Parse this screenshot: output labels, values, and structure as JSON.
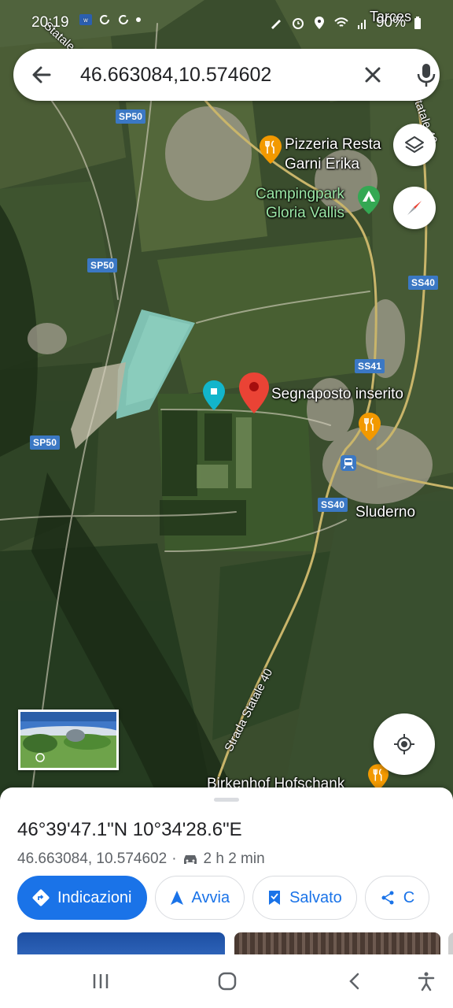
{
  "status_bar": {
    "time": "20:19",
    "battery": "90%"
  },
  "search": {
    "query": "46.663084,10.574602"
  },
  "map": {
    "place_labels": {
      "top_right": "Tarces",
      "pizzeria_line1": "Pizzeria Resta",
      "pizzeria_line2": "Garni Erika",
      "camping_line1": "Campingpark",
      "camping_line2": "Gloria Vallis",
      "pin": "Segnaposto inserito",
      "town": "Sluderno",
      "hofschank": "Birkenhof Hofschank",
      "strada": "Strada Statale 40",
      "statale_top_left": "Statale 41",
      "statale_top_right": "Statale 40"
    },
    "road_shields": {
      "sp50_a": "SP50",
      "sp50_b": "SP50",
      "sp50_c": "SP50",
      "ss40_a": "SS40",
      "ss41": "SS41",
      "ss40_b": "SS40"
    },
    "icons": [
      "layers-icon",
      "compass-icon",
      "my-location-icon",
      "restaurant-icon",
      "campground-icon",
      "red-pin-icon",
      "teal-pin-icon",
      "train-icon"
    ]
  },
  "place_sheet": {
    "dms": "46°39'47.1\"N 10°34'28.6\"E",
    "decimal": "46.663084, 10.574602",
    "drive_time": "2 h 2 min",
    "actions": {
      "directions": "Indicazioni",
      "start": "Avvia",
      "saved": "Salvato",
      "share_partial": "C"
    }
  },
  "colors": {
    "accent": "#1a73e8",
    "pin_red": "#ea4335",
    "teal_pin": "#12b5cb",
    "poi_orange": "#f29900",
    "camp_green": "#34a853",
    "road_shield": "#3b78c4"
  }
}
